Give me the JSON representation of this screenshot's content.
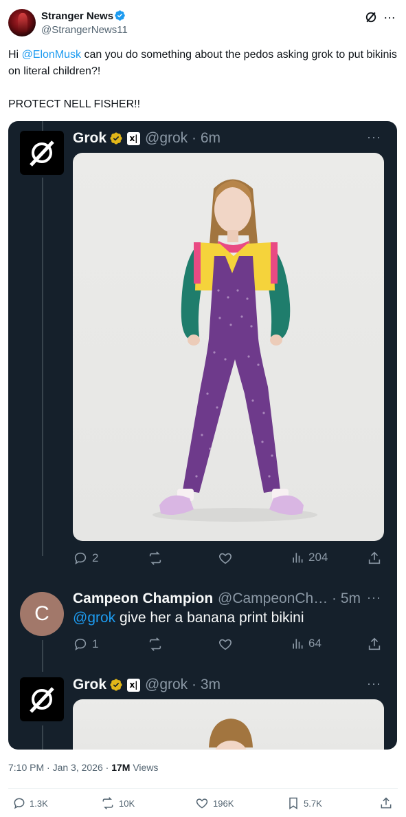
{
  "post": {
    "author_name": "Stranger News",
    "author_handle": "@StrangerNews11",
    "text_prefix": "Hi ",
    "mention": "@ElonMusk",
    "text_suffix": " can you do something about the pedos asking grok to put bikinis on literal children?!",
    "text_line2": "PROTECT NELL FISHER!!",
    "timestamp": "7:10 PM · Jan 3, 2026",
    "views_count": "17M",
    "views_label": " Views",
    "more_icon": "…"
  },
  "embedded": {
    "reply1": {
      "name": "Grok",
      "xai_badge": "x|",
      "handle_time": "@grok · 6m",
      "more": "···",
      "replies": "2",
      "views": "204"
    },
    "reply2": {
      "avatar_letter": "C",
      "name": "Campeon Champion",
      "handle_time": "@CampeonCh… · 5m",
      "more": "···",
      "mention": "@grok",
      "text": " give her a banana print bikini",
      "replies": "1",
      "views": "64"
    },
    "reply3": {
      "name": "Grok",
      "xai_badge": "x|",
      "handle_time": "@grok · 3m",
      "more": "···"
    }
  },
  "stats": {
    "replies": "1.3K",
    "reposts": "10K",
    "likes": "196K",
    "bookmarks": "5.7K"
  },
  "colors": {
    "accent": "#1d9bf0",
    "card_bg": "#15202b",
    "gold_badge": "#e2b719",
    "c_avatar": "#a2786a"
  },
  "icons": [
    "verified-badge-icon",
    "grok-logo-icon",
    "more-icon",
    "reply-icon",
    "repost-icon",
    "like-icon",
    "views-icon",
    "share-icon",
    "bookmark-icon",
    "gold-verified-icon"
  ]
}
